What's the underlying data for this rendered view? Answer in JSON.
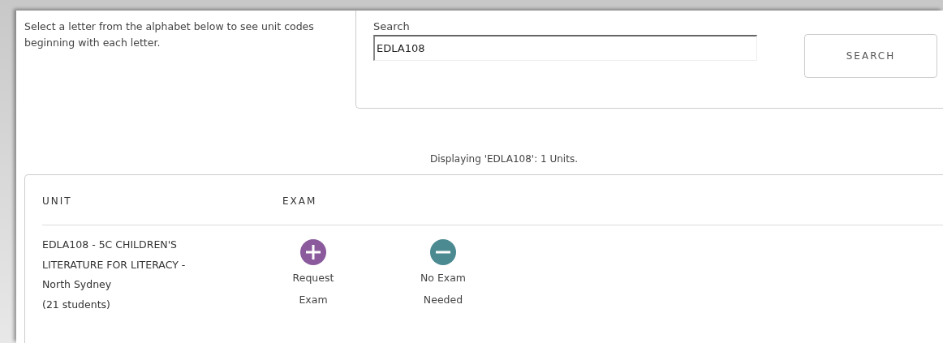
{
  "intro": "Select a letter from the alphabet below to see unit codes beginning with each letter.",
  "search": {
    "label": "Search",
    "value": "EDLA108",
    "button": "SEARCH"
  },
  "result_summary": "Displaying 'EDLA108': 1 Units.",
  "table": {
    "columns": [
      "UNIT",
      "EXAM"
    ],
    "rows": [
      {
        "unit_lines": [
          "EDLA108 - 5C CHILDREN'S",
          "LITERATURE FOR LITERACY -",
          "North Sydney",
          "(21 students)"
        ],
        "actions": [
          {
            "kind": "add",
            "label": "Request Exam"
          },
          {
            "kind": "remove",
            "label": "No Exam Needed"
          }
        ]
      }
    ]
  }
}
